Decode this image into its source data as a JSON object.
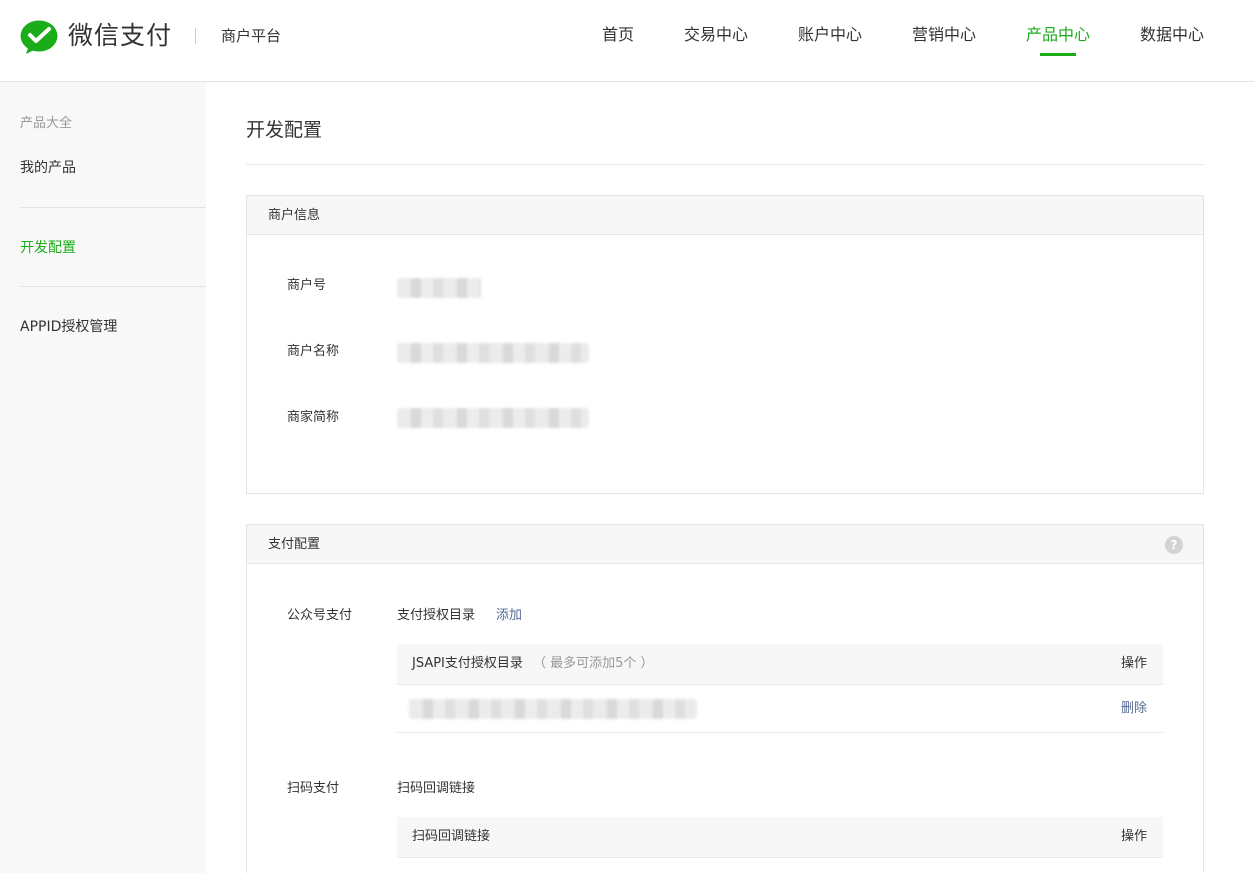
{
  "header": {
    "brand": "微信支付",
    "platform": "商户平台",
    "nav": [
      {
        "label": "首页",
        "active": false
      },
      {
        "label": "交易中心",
        "active": false
      },
      {
        "label": "账户中心",
        "active": false
      },
      {
        "label": "营销中心",
        "active": false
      },
      {
        "label": "产品中心",
        "active": true
      },
      {
        "label": "数据中心",
        "active": false
      }
    ]
  },
  "sidebar": {
    "group_title": "产品大全",
    "items": [
      {
        "label": "我的产品",
        "active": false
      },
      {
        "label": "开发配置",
        "active": true
      },
      {
        "label": "APPID授权管理",
        "active": false
      }
    ]
  },
  "main": {
    "title": "开发配置",
    "merchant_panel": {
      "title": "商户信息",
      "fields": [
        {
          "label": "商户号"
        },
        {
          "label": "商户名称"
        },
        {
          "label": "商家简称"
        }
      ]
    },
    "payment_panel": {
      "title": "支付配置",
      "help_icon": "?",
      "jsapi": {
        "label": "公众号支付",
        "dir_label": "支付授权目录",
        "add_link": "添加",
        "table_header": "JSAPI支付授权目录",
        "table_note": "（ 最多可添加5个 ）",
        "op_header": "操作",
        "row_action": "删除"
      },
      "scan": {
        "label": "扫码支付",
        "callback_label": "扫码回调链接",
        "table_header": "扫码回调链接",
        "op_header": "操作"
      }
    }
  },
  "colors": {
    "brand_green": "#1aad19",
    "link_blue": "#576b95"
  }
}
